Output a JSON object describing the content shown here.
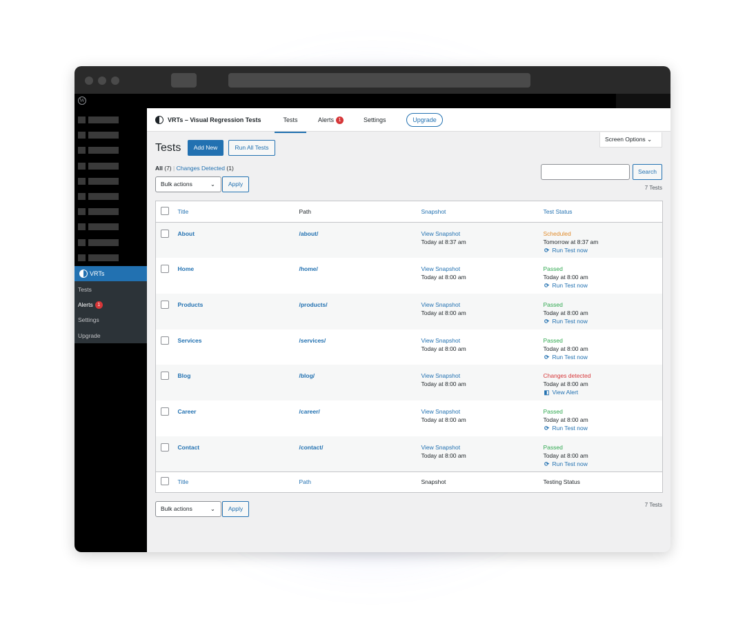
{
  "plugin": {
    "title": "VRTs – Visual Regression Tests",
    "tabs": [
      {
        "label": "Tests"
      },
      {
        "label": "Alerts",
        "badge": "1"
      },
      {
        "label": "Settings"
      }
    ],
    "upgrade": "Upgrade"
  },
  "sidebar": {
    "active": "VRTs",
    "submenu": [
      {
        "label": "Tests"
      },
      {
        "label": "Alerts",
        "badge": "1"
      },
      {
        "label": "Settings"
      },
      {
        "label": "Upgrade"
      }
    ]
  },
  "page": {
    "title": "Tests",
    "add_new": "Add New",
    "run_all": "Run All Tests",
    "screen_options": "Screen Options",
    "filter_all": "All",
    "filter_all_count": "(7)",
    "filter_sep": "|",
    "filter_changes": "Changes Detected",
    "filter_changes_count": "(1)",
    "bulk_actions": "Bulk actions",
    "apply": "Apply",
    "search_button": "Search",
    "search_value": "",
    "count": "7 Tests"
  },
  "table": {
    "headers": {
      "title": "Title",
      "path": "Path",
      "snapshot": "Snapshot",
      "status": "Test Status"
    },
    "footers": {
      "title": "Title",
      "path": "Path",
      "snapshot": "Snapshot",
      "status": "Testing Status"
    },
    "rows": [
      {
        "title": "About",
        "path": "/about/",
        "snapshot": "View Snapshot",
        "snap_time": "Today at 8:37 am",
        "status": "Scheduled",
        "status_type": "scheduled",
        "status_time": "Tomorrow at 8:37 am",
        "action": "Run Test now",
        "action_icon": "refresh-icon"
      },
      {
        "title": "Home",
        "path": "/home/",
        "snapshot": "View Snapshot",
        "snap_time": "Today at 8:00 am",
        "status": "Passed",
        "status_type": "passed",
        "status_time": "Today at 8:00 am",
        "action": "Run Test now",
        "action_icon": "refresh-icon"
      },
      {
        "title": "Products",
        "path": "/products/",
        "snapshot": "View Snapshot",
        "snap_time": "Today at 8:00 am",
        "status": "Passed",
        "status_type": "passed",
        "status_time": "Today at 8:00 am",
        "action": "Run Test now",
        "action_icon": "refresh-icon"
      },
      {
        "title": "Services",
        "path": "/services/",
        "snapshot": "View Snapshot",
        "snap_time": "Today at 8:00 am",
        "status": "Passed",
        "status_type": "passed",
        "status_time": "Today at 8:00 am",
        "action": "Run Test now",
        "action_icon": "refresh-icon"
      },
      {
        "title": "Blog",
        "path": "/blog/",
        "snapshot": "View Snapshot",
        "snap_time": "Today at 8:00 am",
        "status": "Changes detected",
        "status_type": "changes",
        "status_time": "Today at 8:00 am",
        "action": "View Alert",
        "action_icon": "compare-icon"
      },
      {
        "title": "Career",
        "path": "/career/",
        "snapshot": "View Snapshot",
        "snap_time": "Today at 8:00 am",
        "status": "Passed",
        "status_type": "passed",
        "status_time": "Today at 8:00 am",
        "action": "Run Test now",
        "action_icon": "refresh-icon"
      },
      {
        "title": "Contact",
        "path": "/contact/",
        "snapshot": "View Snapshot",
        "snap_time": "Today at 8:00 am",
        "status": "Passed",
        "status_type": "passed",
        "status_time": "Today at 8:00 am",
        "action": "Run Test now",
        "action_icon": "refresh-icon"
      }
    ]
  },
  "colors": {
    "accent": "#2271b1",
    "scheduled": "#e08b2b",
    "passed": "#2fa84f",
    "changes": "#d63638",
    "badge": "#d63638"
  }
}
